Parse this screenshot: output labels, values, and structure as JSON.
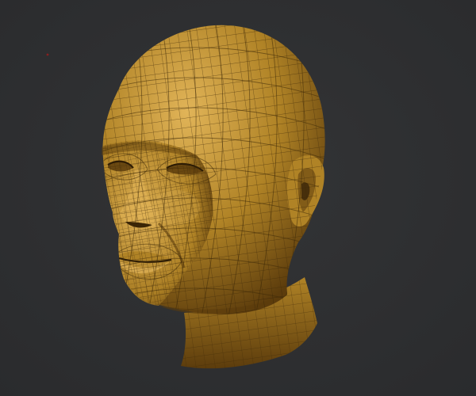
{
  "viewport": {
    "background": "#333436",
    "background_edge": "#2a2b2d"
  },
  "model": {
    "subject": "human-head",
    "display_mode": "wireframe-on-shaded",
    "base_color": "#b08326",
    "highlight_color": "#e1b458",
    "shadow_color": "#5c3c0c",
    "wire_color": "#3d2808"
  },
  "marker": {
    "color": "#8a1f1f"
  }
}
